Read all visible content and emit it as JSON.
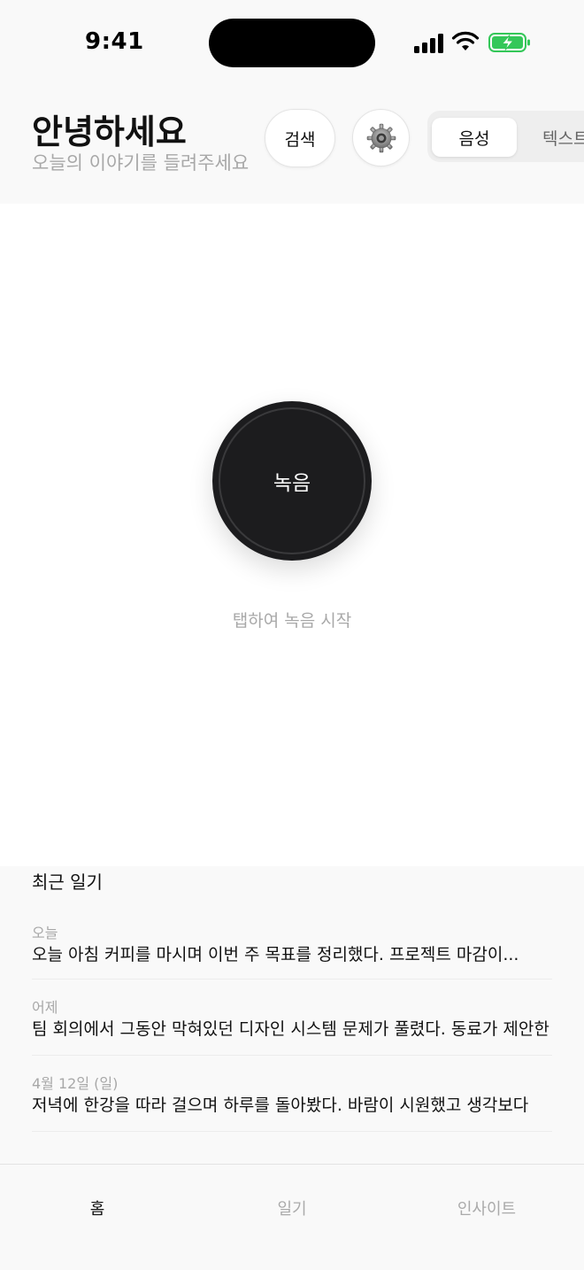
{
  "status_bar": {
    "time": "9:41"
  },
  "header": {
    "greeting": "안녕하세요",
    "subtitle": "오늘의 이야기를 들려주세요",
    "search_label": "검색",
    "mode_tabs": [
      {
        "label": "음성",
        "selected": true
      },
      {
        "label": "텍스트",
        "selected": false
      }
    ]
  },
  "record": {
    "button_label": "녹음",
    "hint": "탭하여 녹음 시작"
  },
  "recent": {
    "title": "최근 일기",
    "entries": [
      {
        "date": "오늘",
        "text": "오늘 아침 커피를 마시며 이번 주 목표를 정리했다. 프로젝트 마감이..."
      },
      {
        "date": "어제",
        "text": "팀 회의에서 그동안 막혀있던 디자인 시스템 문제가 풀렸다. 동료가 제안한"
      },
      {
        "date": "4월 12일 (일)",
        "text": "저녁에 한강을 따라 걸으며 하루를 돌아봤다. 바람이 시원했고 생각보다"
      }
    ]
  },
  "tabbar": {
    "tabs": [
      {
        "label": "홈",
        "active": true
      },
      {
        "label": "일기",
        "active": false
      },
      {
        "label": "인사이트",
        "active": false
      }
    ]
  },
  "colors": {
    "record_button": "#1c1c1e",
    "battery_charging": "#34c759",
    "secondary_text": "#a8a8a8"
  }
}
